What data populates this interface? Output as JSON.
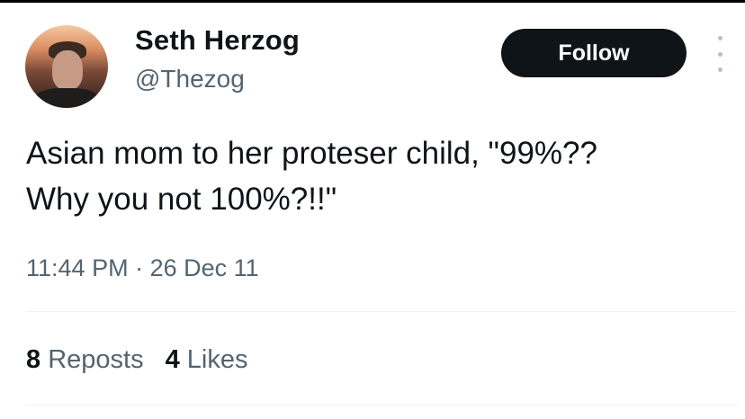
{
  "author": {
    "name": "Seth Herzog",
    "handle": "@Thezog"
  },
  "actions": {
    "follow_label": "Follow",
    "more_icon": "more-vertical-icon"
  },
  "tweet": {
    "text_line1": "Asian mom to her proteser child, \"99%??",
    "text_line2": "Why you not 100%?!!\"",
    "time": "11:44 PM",
    "separator": "·",
    "date": "26 Dec 11"
  },
  "stats": {
    "reposts_count": "8",
    "reposts_label": "Reposts",
    "likes_count": "4",
    "likes_label": "Likes"
  }
}
